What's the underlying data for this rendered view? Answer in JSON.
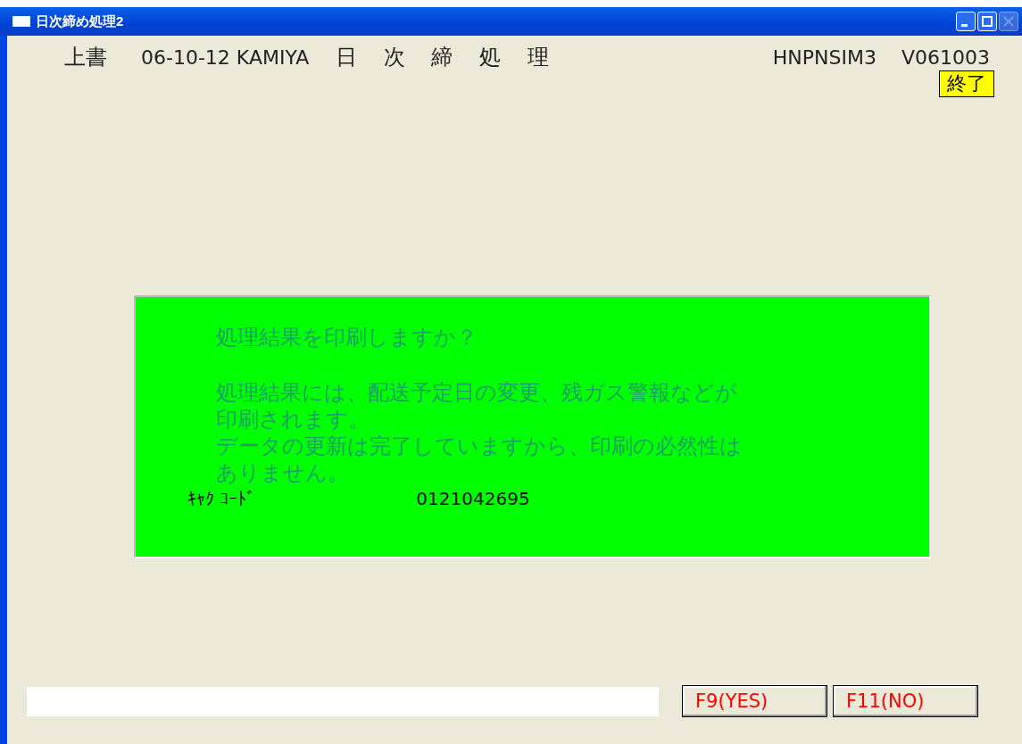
{
  "window": {
    "title": "日次締め処理2",
    "close_enabled": false
  },
  "header": {
    "mode": "上書",
    "date_user": "06-10-12 KAMIYA",
    "screen_title": "日 次 締 処 理",
    "program_id": "HNPNSIM3",
    "version": "V061003"
  },
  "exit_button": "終了",
  "dialog": {
    "question": "処理結果を印刷しますか？",
    "message_lines": [
      "処理結果には、配送予定日の変更、残ガス警報などが",
      "印刷されます。",
      "データの更新は完了していますから、印刷の必然性は",
      "ありません。"
    ],
    "customer_code_label": "ｷｬｸ ｺｰﾄﾞ",
    "customer_code": "0121042695"
  },
  "buttons": [
    "F9(YES)",
    "F11(NO)"
  ]
}
